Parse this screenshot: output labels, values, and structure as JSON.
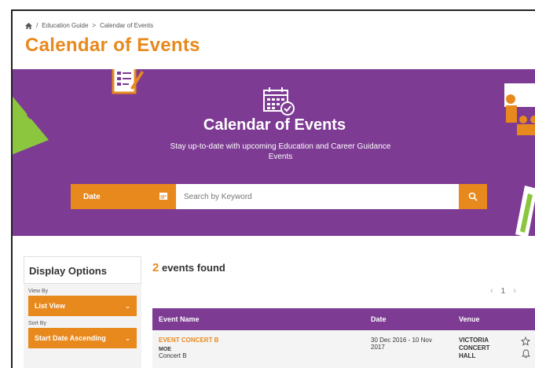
{
  "breadcrumb": {
    "items": [
      "Education Guide",
      "Calendar of Events"
    ],
    "separator_1": "/",
    "separator_2": ">"
  },
  "page": {
    "title": "Calendar of Events"
  },
  "banner": {
    "title": "Calendar of Events",
    "subtitle": "Stay up-to-date with upcoming Education and Career Guidance Events"
  },
  "search": {
    "date_label": "Date",
    "placeholder": "Search by Keyword"
  },
  "display_options": {
    "title": "Display Options",
    "view_by_label": "View By",
    "view_by_value": "List View",
    "sort_by_label": "Sort By",
    "sort_by_value": "Start Date Ascending"
  },
  "results": {
    "count": "2",
    "count_suffix": "events found",
    "page": "1",
    "columns": {
      "name": "Event Name",
      "date": "Date",
      "venue": "Venue"
    },
    "rows": [
      {
        "name": "EVENT CONCERT B",
        "org": "MOE",
        "sub": "Concert B",
        "date": "30 Dec 2016 - 10 Nov 2017",
        "venue": "VICTORIA CONCERT HALL"
      }
    ]
  },
  "colors": {
    "accent": "#e8891d",
    "brand_purple": "#7d3b93"
  },
  "icons": [
    "home-icon",
    "calendar-icon",
    "search-icon",
    "star-icon",
    "bell-icon",
    "chevron-down-icon"
  ]
}
